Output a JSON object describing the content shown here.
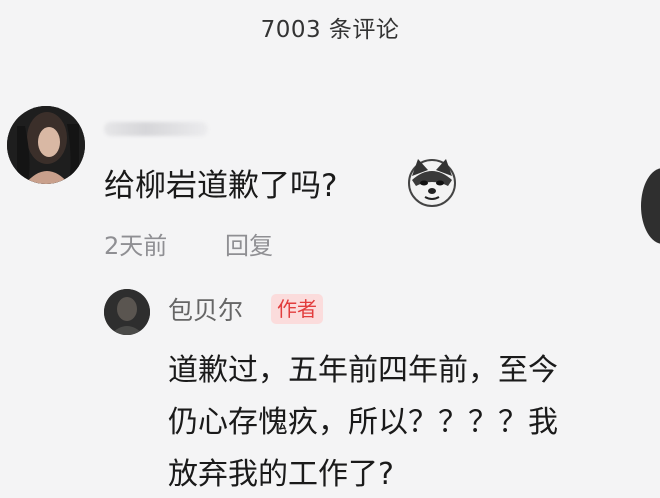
{
  "header": {
    "title": "7003 条评论"
  },
  "comment": {
    "text": "给柳岩道歉了吗?",
    "time": "2天前",
    "reply_label": "回复"
  },
  "reply": {
    "author": "包贝尔",
    "badge": "作者",
    "lines": [
      "道歉过，五年前四年前，至今",
      "仍心存愧疚，所以？？？？我",
      "放弃我的工作了?"
    ]
  },
  "colors": {
    "background": "#f4f4f5",
    "badge_bg": "#fbdcdc",
    "badge_text": "#e23d3d",
    "meta_text": "#8f8f93"
  }
}
